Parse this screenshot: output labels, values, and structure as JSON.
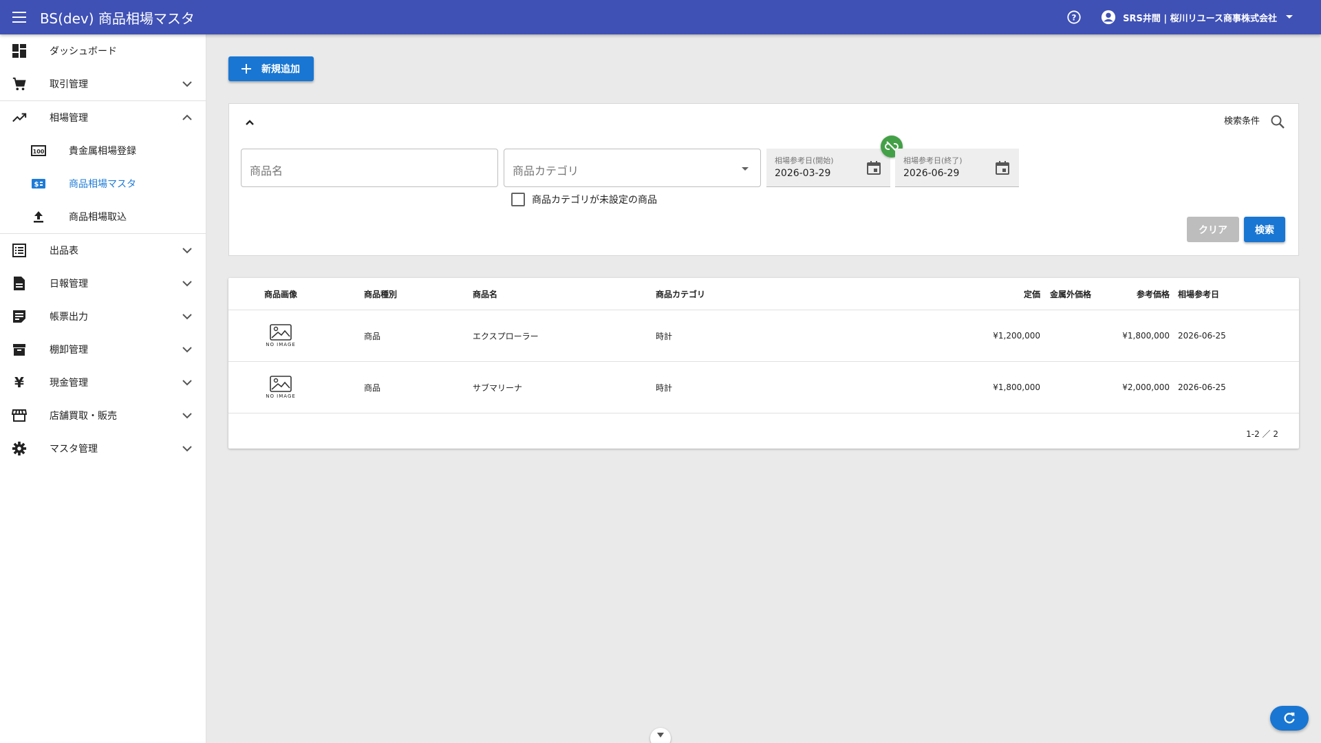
{
  "header": {
    "title": "BS(dev) 商品相場マスタ",
    "user": "SRS井間 | 桜川リユース商事株式会社"
  },
  "sidebar": {
    "items": [
      {
        "label": "ダッシュボード",
        "icon": "dashboard-icon"
      },
      {
        "label": "取引管理",
        "icon": "cart-icon"
      },
      {
        "label": "相場管理",
        "icon": "trending-up-icon"
      },
      {
        "label": "貴金属相場登録",
        "icon": "pin-100-icon"
      },
      {
        "label": "商品相場マスタ",
        "icon": "price-tag-icon"
      },
      {
        "label": "商品相場取込",
        "icon": "upload-icon"
      },
      {
        "label": "出品表",
        "icon": "list-icon"
      },
      {
        "label": "日報管理",
        "icon": "document-icon"
      },
      {
        "label": "帳票出力",
        "icon": "notes-icon"
      },
      {
        "label": "棚卸管理",
        "icon": "archive-icon"
      },
      {
        "label": "現金管理",
        "icon": "yen-icon",
        "glyph": "¥"
      },
      {
        "label": "店舗買取・販売",
        "icon": "store-icon"
      },
      {
        "label": "マスタ管理",
        "icon": "settings-icon"
      }
    ]
  },
  "actions": {
    "add_label": "新規追加"
  },
  "search": {
    "title": "検索条件",
    "name_placeholder": "商品名",
    "category_placeholder": "商品カテゴリ",
    "date_start_label": "相場参考日(開始)",
    "date_start_value": "2026-03-29",
    "date_end_label": "相場参考日(終了)",
    "date_end_value": "2026-06-29",
    "unset_category_label": "商品カテゴリが未設定の商品",
    "clear_label": "クリア",
    "search_label": "検索"
  },
  "table": {
    "headers": [
      "商品画像",
      "商品種別",
      "商品名",
      "商品カテゴリ",
      "定価",
      "金属外価格",
      "参考価格",
      "相場参考日"
    ],
    "no_image_text": "NO IMAGE",
    "rows": [
      {
        "type": "商品",
        "name": "エクスプローラー",
        "category": "時計",
        "list_price": "¥1,200,000",
        "metal_price": "",
        "ref_price": "¥1,800,000",
        "ref_date": "2026-06-25"
      },
      {
        "type": "商品",
        "name": "サブマリーナ",
        "category": "時計",
        "list_price": "¥1,800,000",
        "metal_price": "",
        "ref_price": "¥2,000,000",
        "ref_date": "2026-06-25"
      }
    ],
    "pagination": "1-2 ／ 2"
  },
  "colors": {
    "appbar": "#3f51b5",
    "primary": "#1976d2",
    "link_toggle": "#43a047",
    "active_nav": "#1e7bd6"
  }
}
